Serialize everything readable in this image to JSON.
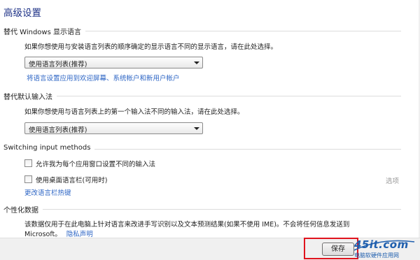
{
  "title": "高级设置",
  "section_display_language": {
    "header": "替代 Windows 显示语言",
    "description": "如果你想使用与安装语言列表的顺序确定的显示语言不同的显示语言，请在此处选择。",
    "select_value": "使用语言列表(推荐)",
    "apply_link": "将语言设置应用到欢迎屏幕、系统帐户和新用户帐户"
  },
  "section_input_method": {
    "header": "替代默认输入法",
    "description": "如果你想使用与语言列表上的第一个输入法不同的输入法，请在此处选择。",
    "select_value": "使用语言列表(推荐)"
  },
  "section_switching": {
    "header": "Switching input methods",
    "checkbox_per_app": "允许我为每个应用窗口设置不同的输入法",
    "checkbox_desktop_bar": "使用桌面语言栏(可用时)",
    "options_link": "选项",
    "hotkeys_link": "更改语言栏热键"
  },
  "section_personalization": {
    "header": "个性化数据",
    "description_line1": "该数据仅用于在此电脑上针对语言来改进手写识别以及文本预测结果(如果不使用 IME)。不会将任何信息发送到",
    "description_line2": "Microsoft。",
    "privacy_link": "隐私声明"
  },
  "footer": {
    "save_label": "保存"
  },
  "watermark": {
    "logo": "45it.com",
    "subtitle": "电脑软硬件应用网"
  },
  "colors": {
    "title": "#1e3287",
    "link": "#2e66c5",
    "highlight_border": "#e0141e",
    "watermark": "#1f5fae"
  }
}
